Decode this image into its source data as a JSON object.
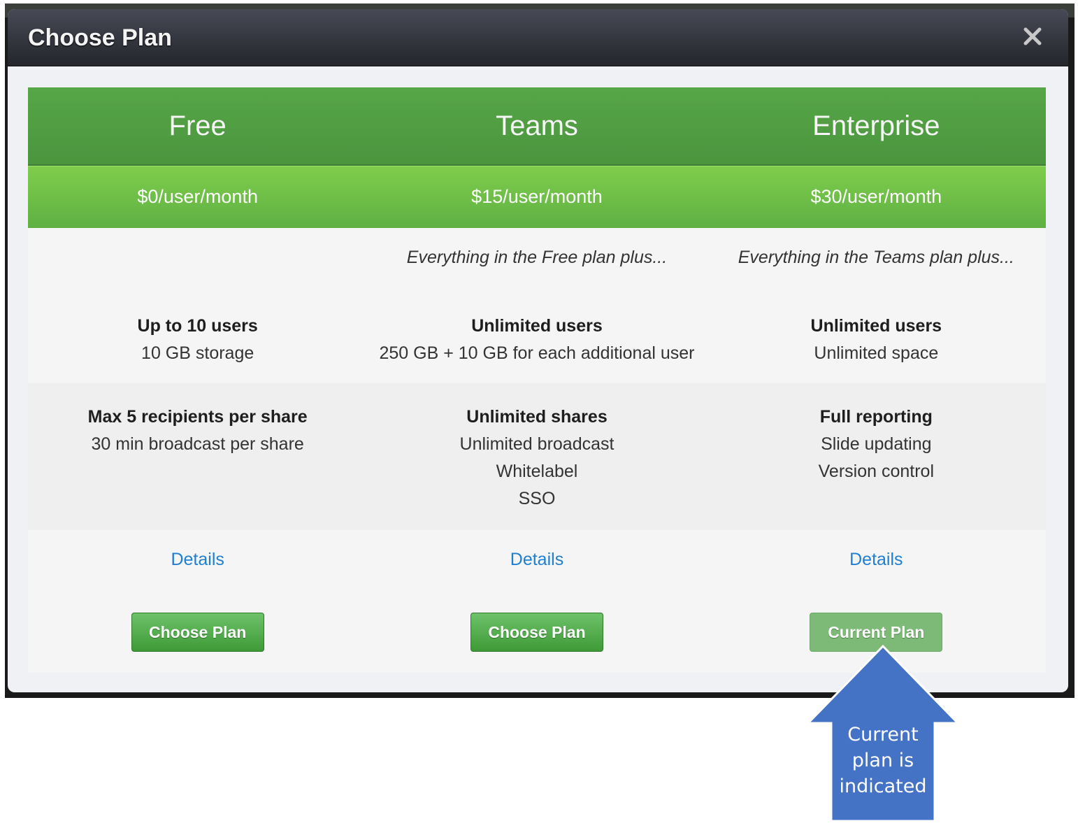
{
  "modal": {
    "title": "Choose Plan",
    "close_icon": "close-icon"
  },
  "plans": [
    {
      "name": "Free",
      "price": "$0/user/month",
      "intro": "",
      "users_bold": "Up to 10 users",
      "users_detail": "10 GB storage",
      "share_bold": "Max 5 recipients per share",
      "share_details": [
        "30 min broadcast per share"
      ],
      "details_link": "Details",
      "button_label": "Choose Plan",
      "is_current": false
    },
    {
      "name": "Teams",
      "price": "$15/user/month",
      "intro": "Everything in the Free plan plus...",
      "users_bold": "Unlimited users",
      "users_detail": "250 GB + 10 GB for each additional user",
      "share_bold": "Unlimited shares",
      "share_details": [
        "Unlimited broadcast",
        "Whitelabel",
        "SSO"
      ],
      "details_link": "Details",
      "button_label": "Choose Plan",
      "is_current": false
    },
    {
      "name": "Enterprise",
      "price": "$30/user/month",
      "intro": "Everything in the Teams plan plus...",
      "users_bold": "Unlimited users",
      "users_detail": "Unlimited space",
      "share_bold": "Full reporting",
      "share_details": [
        "Slide updating",
        "Version control"
      ],
      "details_link": "Details",
      "button_label": "Current Plan",
      "is_current": true
    }
  ],
  "annotation": {
    "text_lines": [
      "Current",
      "plan is",
      "indicated"
    ],
    "color": "#4472c4"
  },
  "colors": {
    "header_green": "#4f9b41",
    "price_green": "#6fbf48",
    "link_blue": "#1f7fd1",
    "button_green": "#3e9a36",
    "current_button": "#7dba77"
  }
}
